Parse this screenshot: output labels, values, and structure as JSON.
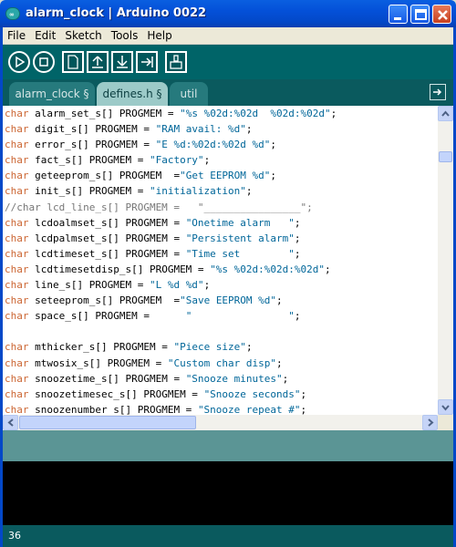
{
  "window": {
    "title": "alarm_clock | Arduino 0022",
    "app_icon_glyph": "∞"
  },
  "menu": [
    "File",
    "Edit",
    "Sketch",
    "Tools",
    "Help"
  ],
  "toolbar": {
    "buttons": [
      "verify-icon",
      "stop-icon",
      "new-icon",
      "open-icon",
      "save-icon",
      "upload-icon",
      "serial-monitor-icon"
    ]
  },
  "tabs": [
    {
      "label": "alarm_clock §",
      "active": false
    },
    {
      "label": "defines.h §",
      "active": true
    },
    {
      "label": "util",
      "active": false
    }
  ],
  "editor": {
    "lines": [
      [
        [
          "kw",
          "char"
        ],
        [
          "t",
          " alarm_set_s[] PROGMEM = "
        ],
        [
          "str",
          "\"%s %02d:%02d  %02d:%02d\""
        ],
        [
          "t",
          ";"
        ]
      ],
      [
        [
          "kw",
          "char"
        ],
        [
          "t",
          " digit_s[] PROGMEM = "
        ],
        [
          "str",
          "\"RAM avail: %d\""
        ],
        [
          "t",
          ";"
        ]
      ],
      [
        [
          "kw",
          "char"
        ],
        [
          "t",
          " error_s[] PROGMEM = "
        ],
        [
          "str",
          "\"E %d:%02d:%02d %d\""
        ],
        [
          "t",
          ";"
        ]
      ],
      [
        [
          "kw",
          "char"
        ],
        [
          "t",
          " fact_s[] PROGMEM = "
        ],
        [
          "str",
          "\"Factory\""
        ],
        [
          "t",
          ";"
        ]
      ],
      [
        [
          "kw",
          "char"
        ],
        [
          "t",
          " geteeprom_s[] PROGMEM  ="
        ],
        [
          "str",
          "\"Get EEPROM %d\""
        ],
        [
          "t",
          ";"
        ]
      ],
      [
        [
          "kw",
          "char"
        ],
        [
          "t",
          " init_s[] PROGMEM = "
        ],
        [
          "str",
          "\"initialization\""
        ],
        [
          "t",
          ";"
        ]
      ],
      [
        [
          "cm",
          "//char lcd_line_s[] PROGMEM =   \"________________\";"
        ]
      ],
      [
        [
          "kw",
          "char"
        ],
        [
          "t",
          " lcdoalmset_s[] PROGMEM = "
        ],
        [
          "str",
          "\"Onetime alarm   \""
        ],
        [
          "t",
          ";"
        ]
      ],
      [
        [
          "kw",
          "char"
        ],
        [
          "t",
          " lcdpalmset_s[] PROGMEM = "
        ],
        [
          "str",
          "\"Persistent alarm\""
        ],
        [
          "t",
          ";"
        ]
      ],
      [
        [
          "kw",
          "char"
        ],
        [
          "t",
          " lcdtimeset_s[] PROGMEM = "
        ],
        [
          "str",
          "\"Time set        \""
        ],
        [
          "t",
          ";"
        ]
      ],
      [
        [
          "kw",
          "char"
        ],
        [
          "t",
          " lcdtimesetdisp_s[] PROGMEM = "
        ],
        [
          "str",
          "\"%s %02d:%02d:%02d\""
        ],
        [
          "t",
          ";"
        ]
      ],
      [
        [
          "kw",
          "char"
        ],
        [
          "t",
          " line_s[] PROGMEM = "
        ],
        [
          "str",
          "\"L %d %d\""
        ],
        [
          "t",
          ";"
        ]
      ],
      [
        [
          "kw",
          "char"
        ],
        [
          "t",
          " seteeprom_s[] PROGMEM  ="
        ],
        [
          "str",
          "\"Save EEPROM %d\""
        ],
        [
          "t",
          ";"
        ]
      ],
      [
        [
          "kw",
          "char"
        ],
        [
          "t",
          " space_s[] PROGMEM =      "
        ],
        [
          "str",
          "\"                \""
        ],
        [
          "t",
          ";"
        ]
      ],
      [
        [
          "t",
          ""
        ]
      ],
      [
        [
          "kw",
          "char"
        ],
        [
          "t",
          " mthicker_s[] PROGMEM = "
        ],
        [
          "str",
          "\"Piece size\""
        ],
        [
          "t",
          ";"
        ]
      ],
      [
        [
          "kw",
          "char"
        ],
        [
          "t",
          " mtwosix_s[] PROGMEM = "
        ],
        [
          "str",
          "\"Custom char disp\""
        ],
        [
          "t",
          ";"
        ]
      ],
      [
        [
          "kw",
          "char"
        ],
        [
          "t",
          " snoozetime_s[] PROGMEM = "
        ],
        [
          "str",
          "\"Snooze minutes\""
        ],
        [
          "t",
          ";"
        ]
      ],
      [
        [
          "kw",
          "char"
        ],
        [
          "t",
          " snoozetimesec_s[] PROGMEM = "
        ],
        [
          "str",
          "\"Snooze seconds\""
        ],
        [
          "t",
          ";"
        ]
      ],
      [
        [
          "kw",
          "char"
        ],
        [
          "t",
          " snoozenumber_s[] PROGMEM = "
        ],
        [
          "str",
          "\"Snooze repeat #\""
        ],
        [
          "t",
          ";"
        ]
      ]
    ]
  },
  "status": {
    "line_number": "36"
  },
  "colors": {
    "keyword": "#cc6633",
    "string": "#006699",
    "comment": "#777777",
    "toolbar_bg": "#006468"
  }
}
